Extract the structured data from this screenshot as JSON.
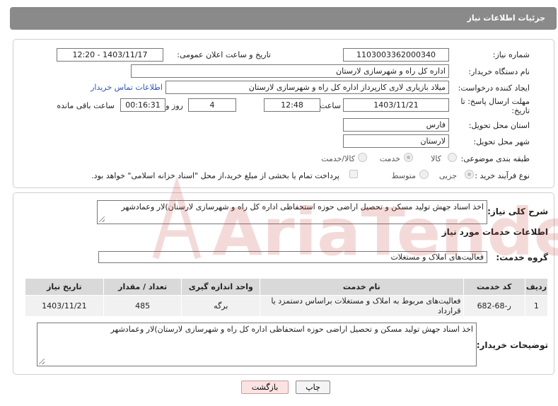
{
  "header": {
    "title": "جزئیات اطلاعات نیاز"
  },
  "form": {
    "need_number_label": "شماره نیاز:",
    "need_number": "1103003362000340",
    "announce_label": "تاریخ و ساعت اعلان عمومی:",
    "announce_value": "1403/11/17 - 12:20",
    "buyer_org_label": "نام دستگاه خریدار:",
    "buyer_org": "اداره کل راه و شهرسازی لارستان",
    "creator_label": "ایجاد کننده درخواست:",
    "creator": "میلاد بازیاری لاری کارپرداز اداره کل راه و شهرسازی لارستان",
    "contact_link": "اطلاعات تماس خریدار",
    "deadline_label_1": "مهلت ارسال پاسخ: تا",
    "deadline_label_2": "تاریخ:",
    "deadline_date": "1403/11/21",
    "time_label": "ساعت",
    "deadline_time": "12:48",
    "days_value": "4",
    "days_label": "روز و",
    "remaining_time": "00:16:31",
    "remaining_label": "ساعت باقی مانده",
    "province_label": "استان محل تحویل:",
    "province": "فارس",
    "city_label": "شهر محل تحویل:",
    "city": "لارستان",
    "category_label": "طبقه بندی موضوعی:",
    "category_options": [
      "کالا",
      "خدمت",
      "کالا/خدمت"
    ],
    "category_selected": "خدمت",
    "process_label": "نوع فرآیند خرید :",
    "process_options": [
      "جزیی",
      "متوسط"
    ],
    "process_selected": "جزیی",
    "payment_note": "پرداخت تمام یا بخشی از مبلغ خرید،از محل \"اسناد خزانه اسلامی\" خواهد بود."
  },
  "description": {
    "label": "شرح کلی نیاز:",
    "text": "اخذ اسناد جهش تولید مسکن و تحصیل اراضی حوزه استحفاظی اداره کل راه و شهرسازی لارستان)لار وعمادشهر"
  },
  "services": {
    "section_title": "اطلاعات خدمات مورد نیاز",
    "group_label": "گروه خدمت:",
    "group_value": "فعالیت‌های  املاک و مستغلات",
    "columns": [
      "ردیف",
      "کد خدمت",
      "نام خدمت",
      "واحد اندازه گیری",
      "تعداد / مقدار",
      "تاریخ نیاز"
    ],
    "rows": [
      [
        "1",
        "ر-68-682",
        "فعالیت‌های مربوط به املاک و مستغلات براساس دستمزد یا قرارداد",
        "برگه",
        "485",
        "1403/11/21"
      ]
    ]
  },
  "buyer_notes": {
    "label": "توضیحات خریدار:",
    "text": "اخذ اسناد جهش تولید مسکن و تحصیل اراضی حوزه استحفاظی اداره کل راه و شهرسازی لارستان)لار وعمادشهر"
  },
  "buttons": {
    "print": "چاپ",
    "back": "بازگشت"
  },
  "watermark": {
    "text": "AriaTender.neT"
  },
  "colors": {
    "header_bg": "#8a8a8a",
    "link": "#2a55c8",
    "table_header": "#d9d9d9",
    "watermark": "#c0392b"
  }
}
